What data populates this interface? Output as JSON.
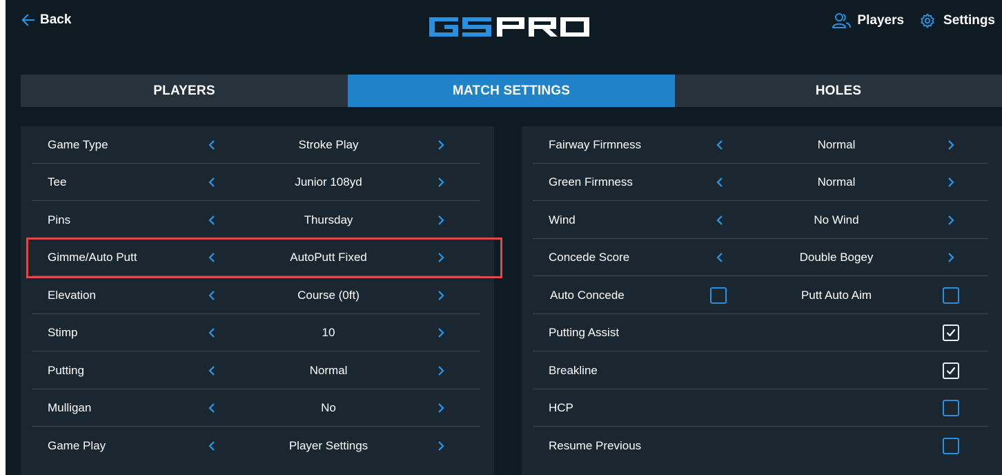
{
  "header": {
    "back_label": "Back",
    "logo_text": "GSPRO",
    "players_label": "Players",
    "settings_label": "Settings"
  },
  "tabs": [
    {
      "label": "PLAYERS",
      "active": false
    },
    {
      "label": "MATCH SETTINGS",
      "active": true
    },
    {
      "label": "HOLES",
      "active": false
    }
  ],
  "left_settings": [
    {
      "label": "Game Type",
      "value": "Stroke Play"
    },
    {
      "label": "Tee",
      "value": "Junior 108yd"
    },
    {
      "label": "Pins",
      "value": "Thursday"
    },
    {
      "label": "Gimme/Auto Putt",
      "value": "AutoPutt Fixed",
      "highlighted": true
    },
    {
      "label": "Elevation",
      "value": "Course (0ft)"
    },
    {
      "label": "Stimp",
      "value": "10"
    },
    {
      "label": "Putting",
      "value": "Normal"
    },
    {
      "label": "Mulligan",
      "value": "No"
    },
    {
      "label": "Game Play",
      "value": "Player Settings"
    }
  ],
  "right_settings": {
    "selectors": [
      {
        "label": "Fairway Firmness",
        "value": "Normal"
      },
      {
        "label": "Green Firmness",
        "value": "Normal"
      },
      {
        "label": "Wind",
        "value": "No Wind"
      },
      {
        "label": "Concede Score",
        "value": "Double Bogey"
      }
    ],
    "auto_concede": {
      "label": "Auto Concede",
      "checked": false
    },
    "putt_auto_aim": {
      "label": "Putt Auto Aim",
      "checked": false
    },
    "checkboxes": [
      {
        "label": "Putting Assist",
        "checked": true
      },
      {
        "label": "Breakline",
        "checked": true
      },
      {
        "label": "HCP",
        "checked": false
      },
      {
        "label": "Resume Previous",
        "checked": false
      }
    ]
  },
  "colors": {
    "background": "#0f1b23",
    "panel": "#1b2730",
    "tab_inactive": "#26333d",
    "tab_active": "#2082c9",
    "accent": "#2a8fdc",
    "highlight": "#e0494b"
  },
  "icons": {
    "back": "arrow-left-icon",
    "players": "users-icon",
    "settings": "gear-icon",
    "prev": "chevron-left-icon",
    "next": "chevron-right-icon",
    "check": "checkmark-icon"
  }
}
